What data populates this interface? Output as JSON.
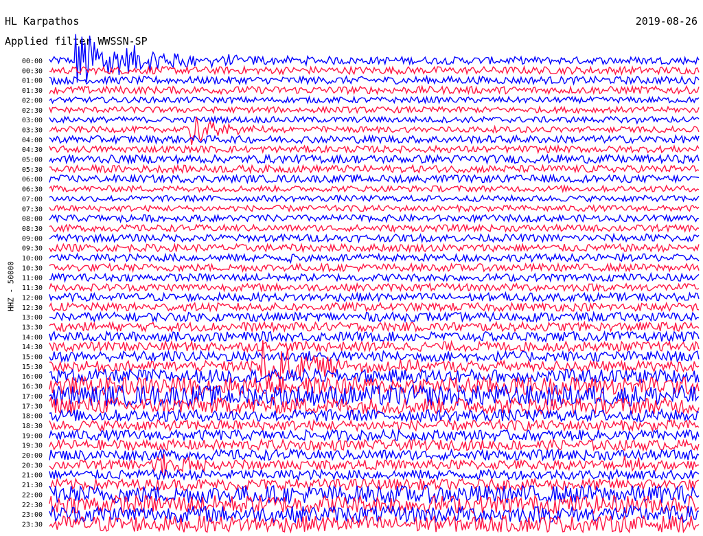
{
  "header": {
    "station": "HL Karpathos",
    "filter": "Applied filter WWSSN-SP",
    "date": "2019-08-26"
  },
  "channel_label": "HHZ - 50000",
  "colors": {
    "trace_a": "#0000ff",
    "trace_b": "#ff1744",
    "background": "#ffffff",
    "text": "#000000"
  },
  "chart_data": {
    "type": "line",
    "title": "HL Karpathos",
    "subtitle": "Applied filter WWSSN-SP",
    "date": "2019-08-26",
    "ylabel": "HHZ - 50000",
    "row_labels": [
      "00:00",
      "00:30",
      "01:00",
      "01:30",
      "02:00",
      "02:30",
      "03:00",
      "03:30",
      "04:00",
      "04:30",
      "05:00",
      "05:30",
      "06:00",
      "06:30",
      "07:00",
      "07:30",
      "08:00",
      "08:30",
      "09:00",
      "09:30",
      "10:00",
      "10:30",
      "11:00",
      "11:30",
      "12:00",
      "12:30",
      "13:00",
      "13:30",
      "14:00",
      "14:30",
      "15:00",
      "15:30",
      "16:00",
      "16:30",
      "17:00",
      "17:30",
      "18:00",
      "18:30",
      "19:00",
      "19:30",
      "20:00",
      "20:30",
      "21:00",
      "21:30",
      "22:00",
      "22:30",
      "23:00",
      "23:30"
    ],
    "x_range_minutes": [
      0,
      30
    ],
    "row_noise_level": [
      1.0,
      1.0,
      1.0,
      1.0,
      0.8,
      0.8,
      0.8,
      0.8,
      1.0,
      0.9,
      1.1,
      1.0,
      1.0,
      0.8,
      0.8,
      0.8,
      0.9,
      0.9,
      1.0,
      1.0,
      1.0,
      1.0,
      1.0,
      1.0,
      1.1,
      1.1,
      1.2,
      1.2,
      1.3,
      1.3,
      1.4,
      1.4,
      1.8,
      2.4,
      2.8,
      2.2,
      1.6,
      1.4,
      1.4,
      1.4,
      1.4,
      1.3,
      1.3,
      1.5,
      2.4,
      2.4,
      2.2,
      2.2
    ],
    "events": [
      {
        "row": 0,
        "minute": 1.2,
        "amplitude": 14,
        "decay": 3.0
      },
      {
        "row": 7,
        "minute": 6.5,
        "amplitude": 7,
        "decay": 1.2
      },
      {
        "row": 31,
        "minute": 9.5,
        "amplitude": 13,
        "decay": 2.5
      },
      {
        "row": 41,
        "minute": 4.8,
        "amplitude": 9,
        "decay": 1.5
      },
      {
        "row": 16,
        "minute": 3.2,
        "amplitude": 1.4,
        "decay": 0.6
      },
      {
        "row": 20,
        "minute": 11.0,
        "amplitude": 1.3,
        "decay": 0.5
      },
      {
        "row": 12,
        "minute": 16.0,
        "amplitude": 1.3,
        "decay": 0.4
      },
      {
        "row": 6,
        "minute": 27.0,
        "amplitude": 1.3,
        "decay": 0.4
      },
      {
        "row": 24,
        "minute": 21.0,
        "amplitude": 1.2,
        "decay": 0.4
      },
      {
        "row": 41,
        "minute": 26.5,
        "amplitude": 4,
        "decay": 1.0
      },
      {
        "row": 18,
        "minute": 27.2,
        "amplitude": 1.2,
        "decay": 0.4
      }
    ]
  }
}
